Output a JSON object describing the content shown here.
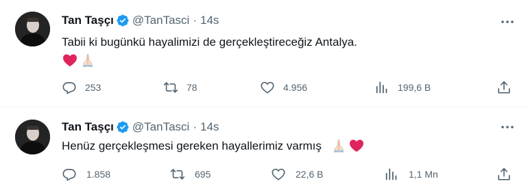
{
  "colors": {
    "text": "#0f1419",
    "secondary": "#536471",
    "verified": "#1d9bf0",
    "heart": "#e0245e"
  },
  "tweets": [
    {
      "author": {
        "name": "Tan Taşçı",
        "handle": "@TanTasci"
      },
      "separator": "·",
      "time": "14s",
      "text": "Tabii ki bugünkü hayalimizi de gerçekleştireceğiz Antalya.",
      "emojis": [
        "red-heart-icon",
        "folded-hands-icon"
      ],
      "stats": {
        "replies": "253",
        "retweets": "78",
        "likes": "4.956",
        "views": "199,6 B"
      }
    },
    {
      "author": {
        "name": "Tan Taşçı",
        "handle": "@TanTasci"
      },
      "separator": "·",
      "time": "14s",
      "text": "Henüz gerçekleşmesi gereken hayallerimiz varmış",
      "emojis": [
        "folded-hands-icon",
        "red-heart-icon"
      ],
      "stats": {
        "replies": "1.858",
        "retweets": "695",
        "likes": "22,6 B",
        "views": "1,1 Mn"
      }
    }
  ]
}
